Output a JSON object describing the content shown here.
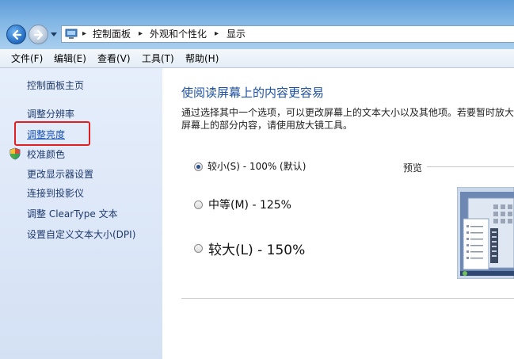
{
  "address_bar": {
    "breadcrumbs": [
      "控制面板",
      "外观和个性化",
      "显示"
    ]
  },
  "menu": {
    "items": [
      "文件(F)",
      "编辑(E)",
      "查看(V)",
      "工具(T)",
      "帮助(H)"
    ]
  },
  "sidebar": {
    "home": "控制面板主页",
    "links": [
      "调整分辨率",
      "调整亮度",
      "校准颜色",
      "更改显示器设置",
      "连接到投影仪",
      "调整 ClearType 文本",
      "设置自定义文本大小(DPI)"
    ]
  },
  "main": {
    "title": "使阅读屏幕上的内容更容易",
    "description": "通过选择其中一个选项，可以更改屏幕上的文本大小以及其他项。若要暂时放大屏幕上的部分内容，请使用放大镜工具。",
    "options": [
      {
        "label": "较小(S) - 100% (默认)",
        "checked": true
      },
      {
        "label": "中等(M) - 125%",
        "checked": false
      },
      {
        "label": "较大(L) - 150%",
        "checked": false
      }
    ],
    "preview_label": "预览"
  },
  "colors": {
    "link": "#1e3a6e",
    "title": "#1e4fa0",
    "highlight": "#e02020"
  },
  "icons": [
    "back-arrow-icon",
    "forward-arrow-icon",
    "control-panel-icon",
    "shield-icon"
  ]
}
